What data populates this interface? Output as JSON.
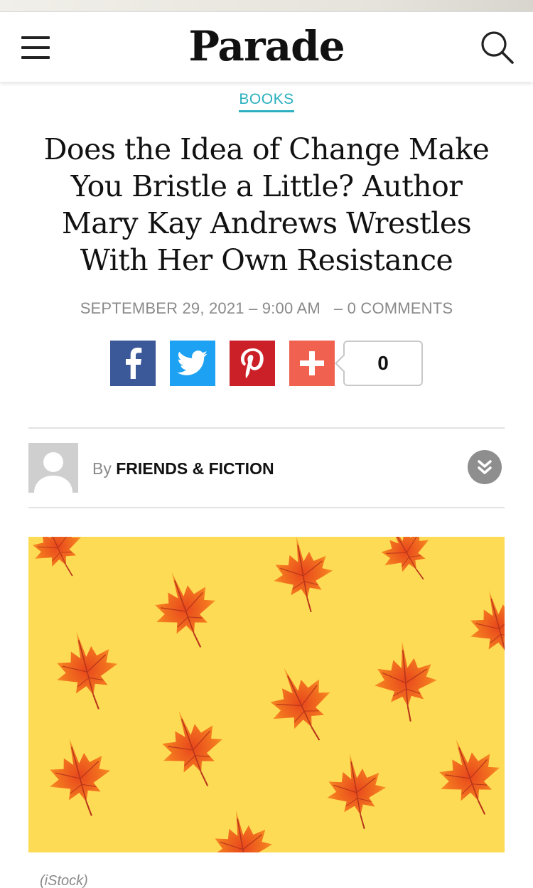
{
  "header": {
    "logo": "Parade",
    "menu_icon": "hamburger-menu-icon",
    "search_icon": "search-icon"
  },
  "article": {
    "category": "BOOKS",
    "headline_lines": [
      "Does the Idea of Change Make",
      "You Bristle a Little? Author",
      "Mary Kay Andrews Wrestles",
      "With Her Own Resistance"
    ],
    "date": "SEPTEMBER 29, 2021",
    "time": "9:00 AM",
    "comments": "0 COMMENTS",
    "byline_prefix": "By",
    "author": "FRIENDS & FICTION",
    "image_caption": "(iStock)"
  },
  "share": {
    "buttons": [
      "facebook-icon",
      "twitter-icon",
      "pinterest-icon",
      "plus-icon"
    ],
    "count": "0"
  },
  "colors": {
    "accent": "#2bb0bf",
    "facebook": "#3b5998",
    "twitter": "#1da1f2",
    "pinterest": "#cb2027",
    "share_more": "#f0624f",
    "hero_background": "#fedb55"
  }
}
